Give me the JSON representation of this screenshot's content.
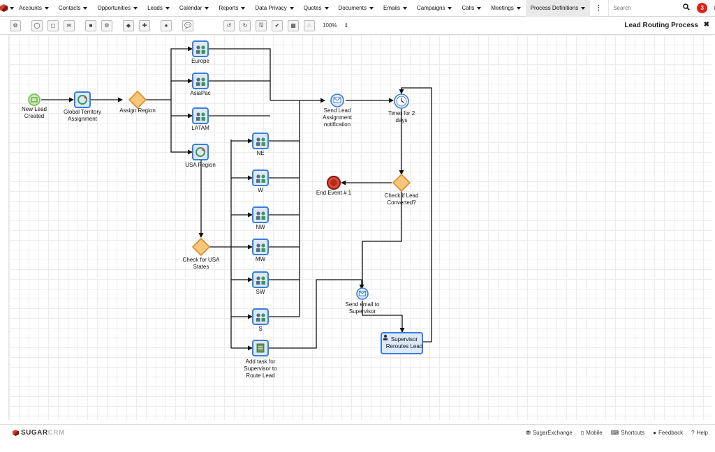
{
  "nav": {
    "items": [
      {
        "label": "Accounts"
      },
      {
        "label": "Contacts"
      },
      {
        "label": "Opportunities"
      },
      {
        "label": "Leads"
      },
      {
        "label": "Calendar"
      },
      {
        "label": "Reports"
      },
      {
        "label": "Data Privacy"
      },
      {
        "label": "Quotes"
      },
      {
        "label": "Documents"
      },
      {
        "label": "Emails"
      },
      {
        "label": "Campaigns"
      },
      {
        "label": "Calls"
      },
      {
        "label": "Meetings"
      },
      {
        "label": "Process Definitions"
      }
    ],
    "active": "Process Definitions",
    "search_placeholder": "Search",
    "notification_count": "3"
  },
  "toolbar": {
    "zoom": "100%",
    "process_title": "Lead Routing Process",
    "close_glyph": "✖"
  },
  "diagram": {
    "nodes": {
      "new_lead": "New Lead\nCreated",
      "global_territory": "Global Territory\nAssignment",
      "assign_region": "Assign Region",
      "europe": "Europe",
      "asiapac": "AsiaPac",
      "latam": "LATAM",
      "usa_region": "USA Region",
      "ne": "NE",
      "w": "W",
      "nw": "NW",
      "mw": "MW",
      "sw": "SW",
      "s": "S",
      "check_usa": "Check for USA\nStates",
      "add_task": "Add task for\nSupervisor to\nRoute Lead",
      "send_notification": "Send Lead\nAssignment\nnotification",
      "timer": "Timer for 2\ndays",
      "end_event": "End Event # 1",
      "check_converted": "Check if Lead\nConverted?",
      "send_email": "Send email to\nSupervisor",
      "supervisor_reroutes": "Supervisor\nReroutes Lead"
    },
    "colors": {
      "task_border": "#3b7dd8",
      "task_fill": "#dce9fa",
      "gateway": "#f0a23b",
      "start": "#7cc35a",
      "end": "#c0392b"
    }
  },
  "footer": {
    "brand_sugar": "SUGAR",
    "brand_crm": "CRM",
    "links": [
      {
        "icon": "⛃",
        "label": "SugarExchange"
      },
      {
        "icon": "▯",
        "label": "Mobile"
      },
      {
        "icon": "⌨",
        "label": "Shortcuts"
      },
      {
        "icon": "●",
        "label": "Feedback"
      },
      {
        "icon": "?",
        "label": "Help"
      }
    ]
  }
}
